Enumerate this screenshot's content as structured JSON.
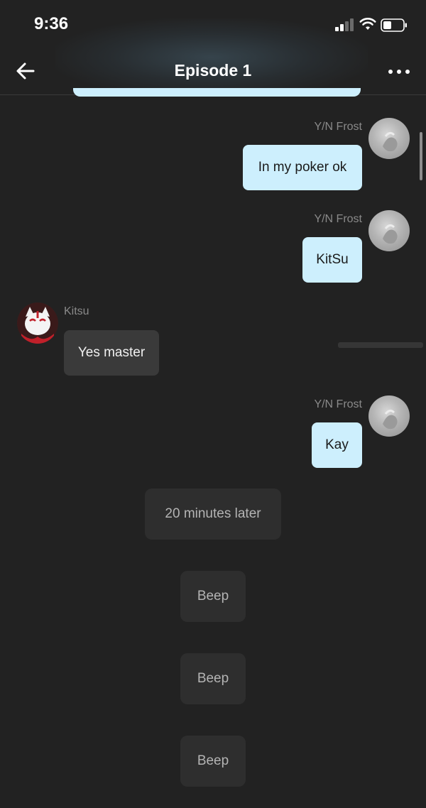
{
  "status_bar": {
    "time": "9:36"
  },
  "header": {
    "title": "Episode 1"
  },
  "messages": [
    {
      "sender": "Y/N Frost",
      "text": "In my poker ok",
      "side": "right"
    },
    {
      "sender": "Y/N Frost",
      "text": "KitSu",
      "side": "right"
    },
    {
      "sender": "Kitsu",
      "text": "Yes master",
      "side": "left"
    },
    {
      "sender": "Y/N Frost",
      "text": "Kay",
      "side": "right"
    }
  ],
  "narrations": [
    "20 minutes later",
    "Beep",
    "Beep",
    "Beep"
  ],
  "colors": {
    "background": "#222222",
    "user_bubble": "#cdeffd",
    "other_bubble": "#3a3a3a",
    "narration_bubble": "#2e2e2e"
  },
  "icons": [
    "back-arrow-icon",
    "more-dots-icon",
    "signal-icon",
    "wifi-icon",
    "battery-icon"
  ]
}
